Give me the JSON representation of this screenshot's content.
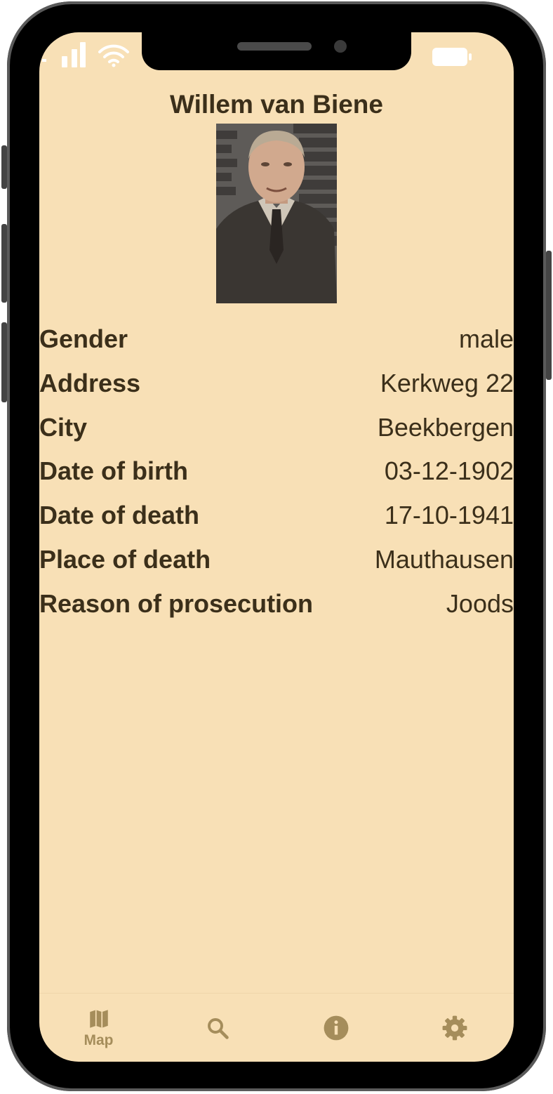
{
  "colors": {
    "screen_background": "#f8e0b6",
    "text": "#3b2f1a",
    "tab_icon": "#a58d5b"
  },
  "status_bar": {
    "icons": [
      "signal-icon",
      "wifi-icon",
      "battery-icon"
    ]
  },
  "person": {
    "name": "Willem van Biene",
    "photo_icon": "portrait-photo"
  },
  "details": [
    {
      "label": "Gender",
      "value": "male"
    },
    {
      "label": "Address",
      "value": "Kerkweg 22"
    },
    {
      "label": "City",
      "value": "Beekbergen"
    },
    {
      "label": "Date of birth",
      "value": "03-12-1902"
    },
    {
      "label": "Date of death",
      "value": "17-10-1941"
    },
    {
      "label": "Place of death",
      "value": "Mauthausen"
    },
    {
      "label": "Reason of prosecution",
      "value": "Joods"
    }
  ],
  "tabbar": {
    "tabs": [
      {
        "icon": "map-icon",
        "label": "Map"
      },
      {
        "icon": "search-icon",
        "label": ""
      },
      {
        "icon": "info-icon",
        "label": ""
      },
      {
        "icon": "gear-icon",
        "label": ""
      }
    ]
  }
}
